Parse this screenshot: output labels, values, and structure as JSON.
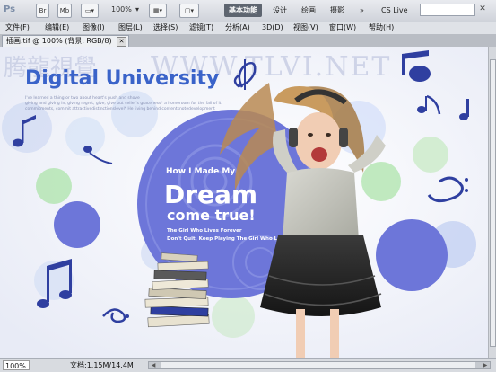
{
  "app": {
    "logo": "Ps"
  },
  "toolbar": {
    "br_label": "Br",
    "mb_label": "Mb",
    "zoom_label": "100%",
    "workspaces": [
      "基本功能",
      "设计",
      "绘画",
      "摄影"
    ],
    "cs_live": "CS Live",
    "search_placeholder": ""
  },
  "window_controls": {
    "minimize": "–",
    "restore": "▫",
    "close": "✕"
  },
  "menus": [
    "文件(F)",
    "编辑(E)",
    "图像(I)",
    "图层(L)",
    "选择(S)",
    "滤镜(T)",
    "分析(A)",
    "3D(D)",
    "视图(V)",
    "窗口(W)",
    "帮助(H)"
  ],
  "document_tab": {
    "title": "插画.tif @ 100% (背景, RGB/8)",
    "close": "✕"
  },
  "artwork": {
    "watermark": "WWW.TLVI.NET",
    "watermark_cn": "腾龍視覺",
    "title": "Digital University",
    "intro_lines": [
      "I've learned a thing or two about heart's push and shove",
      "giving and giving in, giving regret, give, give but seller's graceness* a homeroom for the fall of it",
      "commitments, commit attractivedistinctionslevel* He living behind contentsnotedevelopment"
    ],
    "heading_small": "How I Made My",
    "heading_big": "Dream",
    "heading_sub": "come true!",
    "subtitle1": "The Girl Who Lives Forever",
    "subtitle2": "Don't Quit, Keep Playing The Girl Who Lives"
  },
  "statusbar": {
    "zoom": "100%",
    "doc_label": "文档:1.15M/14.4M"
  },
  "colors": {
    "accent_blue": "#2f3fa0",
    "circle_blue": "#6d76d9",
    "circle_green": "#a8e3a5",
    "title_blue": "#3a63c9"
  }
}
